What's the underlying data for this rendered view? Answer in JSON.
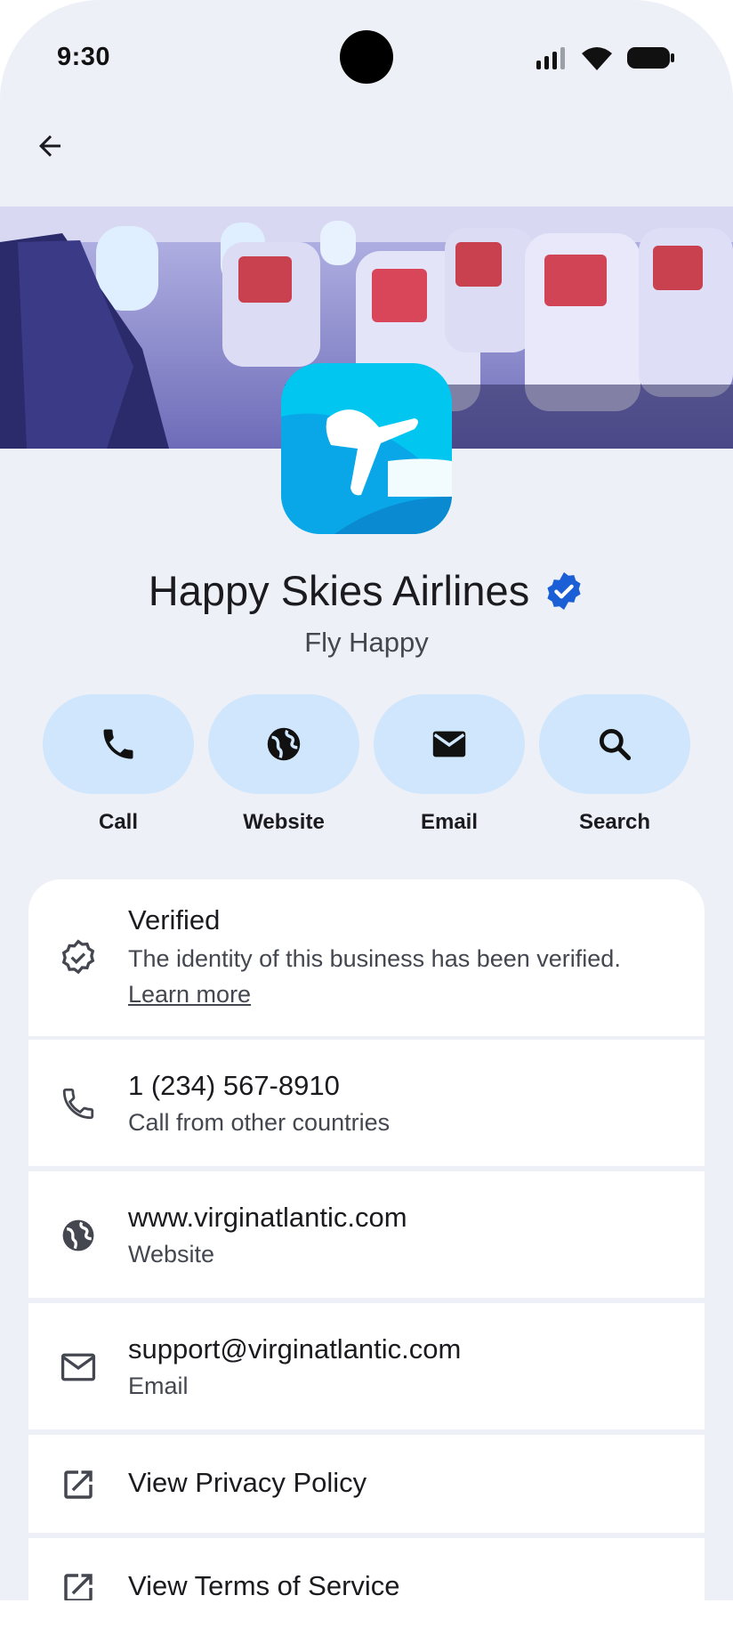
{
  "status_bar": {
    "time": "9:30"
  },
  "header": {
    "back_icon": "arrow-back-icon"
  },
  "business": {
    "name": "Happy Skies Airlines",
    "tagline": "Fly Happy",
    "verified_badge_color": "#1a5fd6",
    "logo_colors": [
      "#0aa7e8",
      "#00c6f0",
      "#ffffff"
    ]
  },
  "actions": [
    {
      "label": "Call",
      "icon": "phone-icon"
    },
    {
      "label": "Website",
      "icon": "globe-icon"
    },
    {
      "label": "Email",
      "icon": "mail-icon"
    },
    {
      "label": "Search",
      "icon": "search-icon"
    }
  ],
  "details": {
    "verified": {
      "title": "Verified",
      "description": "The identity of this business has been verified.",
      "link": "Learn more"
    },
    "phone": {
      "value": "1 (234) 567-8910",
      "caption": "Call from other countries"
    },
    "website": {
      "value": "www.virginatlantic.com",
      "caption": "Website"
    },
    "email": {
      "value": "support@virginatlantic.com",
      "caption": "Email"
    },
    "privacy": {
      "label": "View Privacy Policy"
    },
    "terms": {
      "label": "View Terms of Service"
    }
  },
  "colors": {
    "accent_pill": "#cfe6fc",
    "background": "#eef0f7",
    "link": "#0b57d0"
  }
}
